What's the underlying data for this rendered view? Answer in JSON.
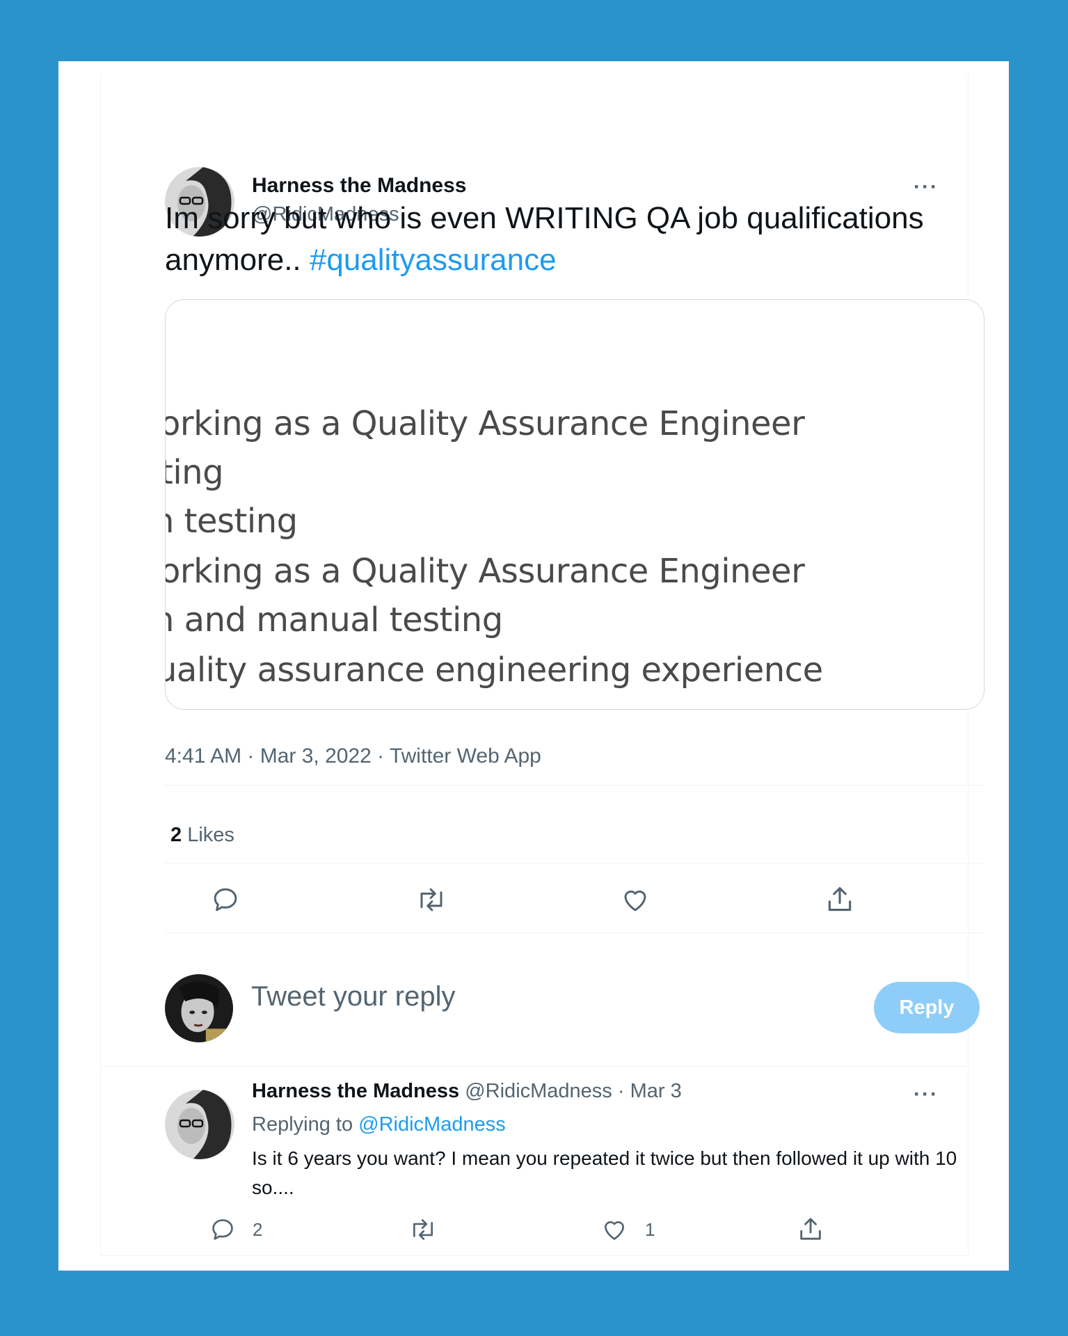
{
  "tweet": {
    "author_name": "Harness the Madness",
    "author_handle": "@RidicMadness",
    "more": "···",
    "text": "Im sorry but who is even WRITING QA job qualifications anymore.. ",
    "hashtag": "#qualityassurance",
    "media_lines": [
      "orking as a Quality Assurance Engineer",
      "ting",
      "n testing",
      "orking as a Quality Assurance Engineer",
      "n and manual testing",
      "uality assurance engineering experience"
    ],
    "meta": "4:41 AM · Mar 3, 2022 · Twitter Web App",
    "likes_count": "2",
    "likes_label": " Likes"
  },
  "composer": {
    "placeholder": "Tweet your reply",
    "reply_button": "Reply"
  },
  "reply": {
    "author_name": "Harness the Madness",
    "author_handle": "@RidicMadness",
    "date": " · Mar 3",
    "more": "···",
    "replying_prefix": "Replying to ",
    "replying_to": "@RidicMadness",
    "text": "Is it 6 years you want? I mean you repeated it twice but then followed it up with 10 so....",
    "reply_count": "2",
    "like_count": "1"
  },
  "icons": [
    "comment-icon",
    "retweet-icon",
    "like-icon",
    "share-icon",
    "more-icon"
  ],
  "colors": {
    "background": "#2b93cc",
    "accent": "#1d9bf0",
    "reply_button": "#8ecdf8",
    "muted_text": "#536471"
  }
}
